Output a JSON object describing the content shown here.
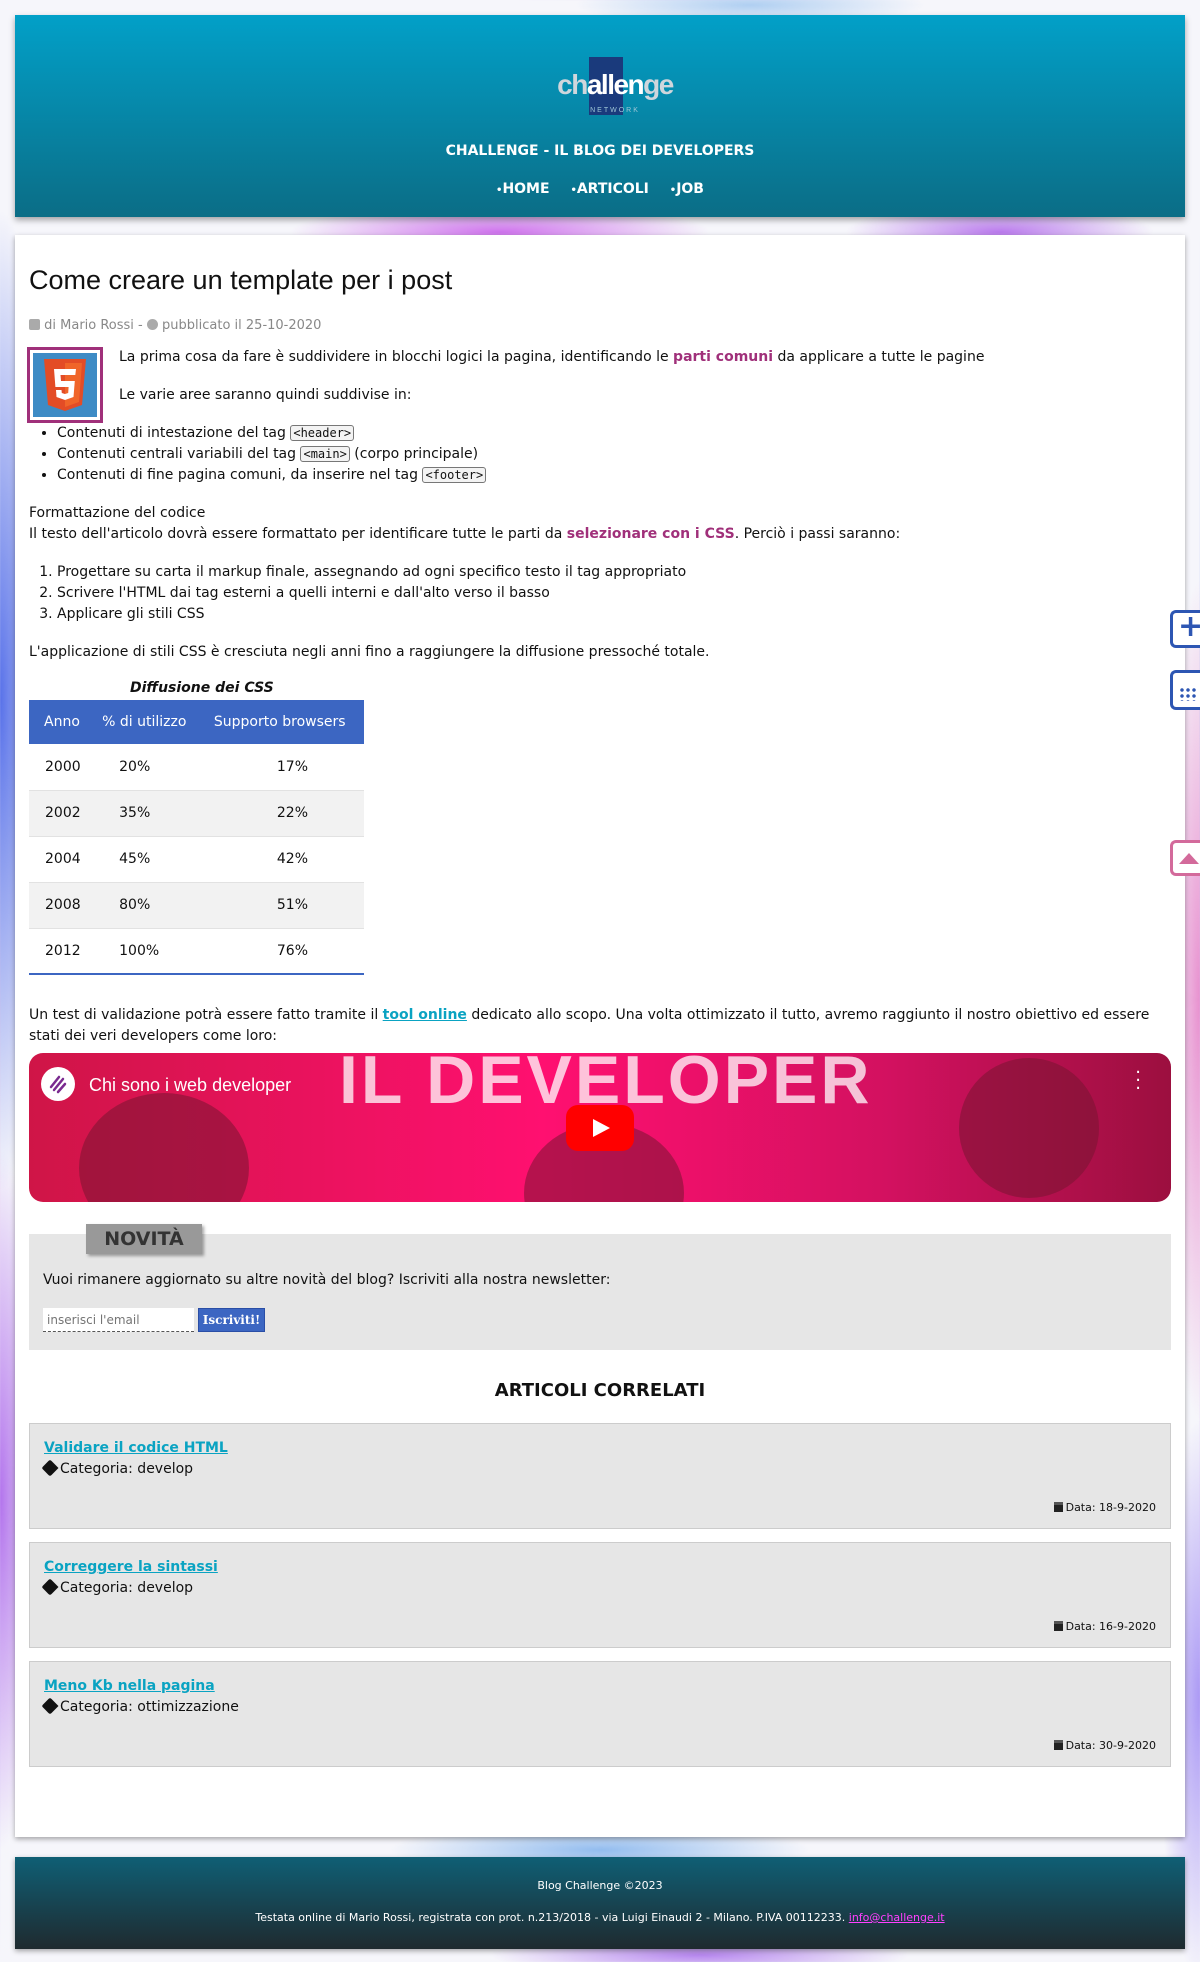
{
  "header": {
    "logo": {
      "text_pre": "ch",
      "text_mid": "allen",
      "text_post": "ge",
      "sub": "NETWORK"
    },
    "site_title": "CHALLENGE - IL BLOG DEI DEVELOPERS",
    "nav": [
      "HOME",
      "ARTICOLI",
      "JOB"
    ]
  },
  "post": {
    "title": "Come creare un template per i post",
    "author": "di Mario Rossi -",
    "published": "pubblicato il 25-10-2020",
    "intro_before": "La prima cosa da fare è suddividere in blocchi logici la pagina, identificando le ",
    "intro_highlight": "parti comuni",
    "intro_after": " da applicare a tutte le pagine",
    "areas_intro": "Le varie aree saranno quindi suddivise in:",
    "areas": [
      {
        "text": "Contenuti di intestazione del tag ",
        "code": "<header>",
        "after": ""
      },
      {
        "text": "Contenuti centrali variabili del tag ",
        "code": "<main>",
        "after": " (corpo principale)"
      },
      {
        "text": "Contenuti di fine pagina comuni, da inserire nel tag ",
        "code": "<footer>",
        "after": ""
      }
    ],
    "format_title": "Formattazione del codice",
    "format_before": "Il testo dell'articolo dovrà essere formattato per identificare tutte le parti da ",
    "format_highlight": "selezionare con i CSS",
    "format_after": ". Perciò i passi saranno:",
    "steps": [
      "Progettare su carta il markup finale, assegnando ad ogni specifico testo il tag appropriato",
      "Scrivere l'HTML dai tag esterni a quelli interni e dall'alto verso il basso",
      "Applicare gli stili CSS"
    ],
    "css_growth": "L'applicazione di stili CSS è cresciuta negli anni fino a raggiungere la diffusione pressoché totale.",
    "table": {
      "caption": "Diffusione dei CSS",
      "headers": [
        "Anno",
        "% di utilizzo",
        "Supporto browsers"
      ],
      "rows": [
        [
          "2000",
          "20%",
          "17%"
        ],
        [
          "2002",
          "35%",
          "22%"
        ],
        [
          "2004",
          "45%",
          "42%"
        ],
        [
          "2008",
          "80%",
          "51%"
        ],
        [
          "2012",
          "100%",
          "76%"
        ]
      ]
    },
    "validation_before": "Un test di validazione potrà essere fatto tramite il ",
    "validation_link": "tool online",
    "validation_after": " dedicato allo scopo. Una volta ottimizzato il tutto, avremo raggiunto il nostro obiettivo ed essere stati dei veri developers come loro:",
    "video": {
      "title": "Chi sono i web developer",
      "overlay": "IL DEVELOPER"
    }
  },
  "newsletter": {
    "tab": "NOVITÀ",
    "text": "Vuoi rimanere aggiornato su altre novità del blog? Iscriviti alla nostra newsletter:",
    "placeholder": "inserisci l'email",
    "button": "Iscriviti!"
  },
  "related": {
    "title": "ARTICOLI CORRELATI",
    "items": [
      {
        "title": "Validare il codice HTML",
        "category": "Categoria: develop",
        "date": "Data: 18-9-2020"
      },
      {
        "title": "Correggere la sintassi",
        "category": "Categoria: develop",
        "date": "Data: 16-9-2020"
      },
      {
        "title": "Meno Kb nella pagina",
        "category": "Categoria: ottimizzazione",
        "date": "Data: 30-9-2020"
      }
    ]
  },
  "footer": {
    "copyright": "Blog Challenge ©2023",
    "legal": "Testata online di Mario Rossi, registrata con prot. n.213/2018 - via Luigi Einaudi 2 - Milano. P.IVA 00112233. ",
    "email": "info@challenge.it"
  },
  "colors": {
    "header_top": "#02a0c8",
    "header_bottom": "#0b6d86",
    "accent": "#3c66c2",
    "highlight": "#a0307a",
    "link": "#0aa3c2"
  }
}
